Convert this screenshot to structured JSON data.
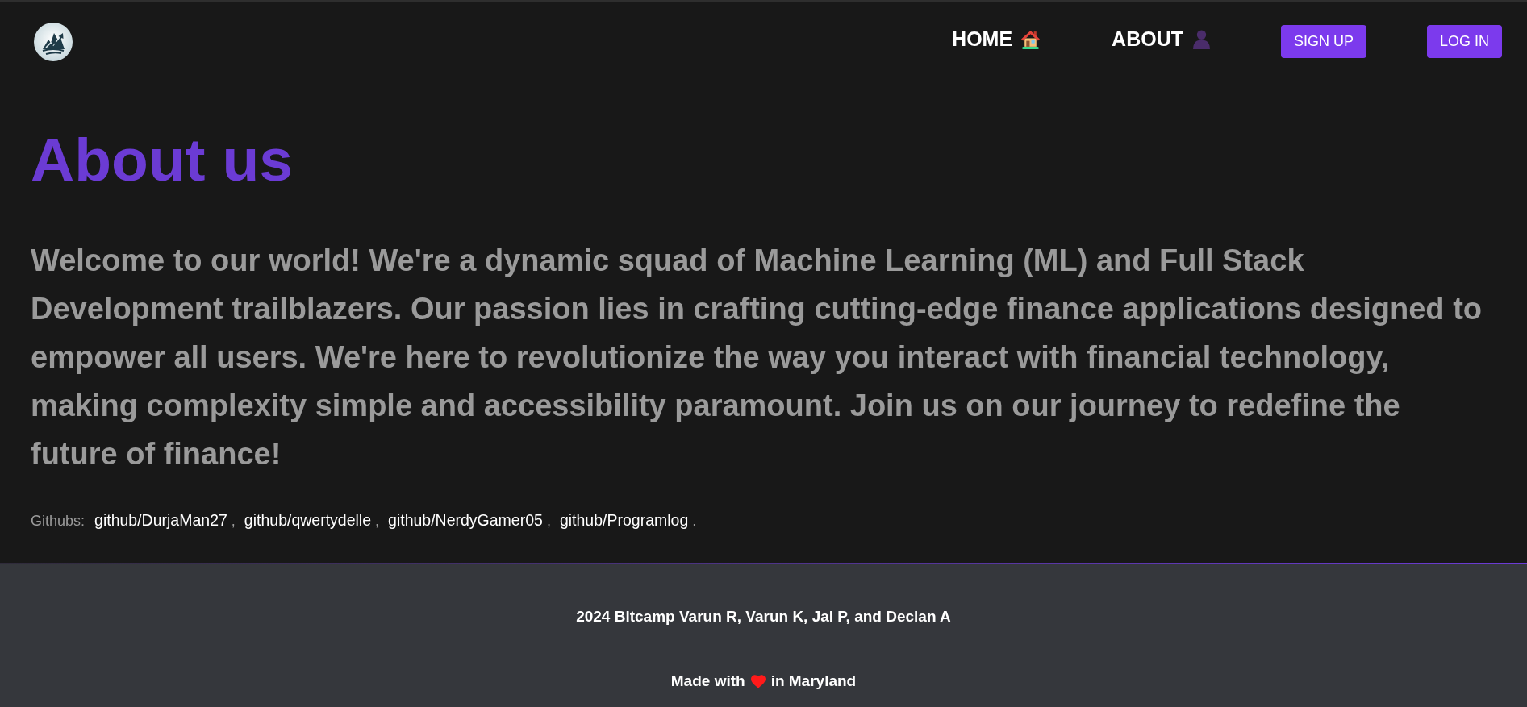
{
  "header": {
    "nav_links": [
      {
        "label": "HOME",
        "kind": "home"
      },
      {
        "label": "ABOUT",
        "kind": "about"
      }
    ],
    "buttons": [
      "SIGN UP",
      "LOG IN"
    ]
  },
  "main": {
    "title": "About us",
    "intro": "Welcome to our world! We're a dynamic squad of Machine Learning (ML) and Full Stack Development trailblazers. Our passion lies in crafting cutting-edge finance applications designed to empower all users. We're here to revolutionize the way you interact with financial technology, making complexity simple and accessibility paramount. Join us on our journey to redefine the future of finance!",
    "githubs": {
      "label": "Githubs:",
      "links": [
        {
          "text": "github/DurjaMan27",
          "after": ","
        },
        {
          "text": "github/qwertydelle",
          "after": ","
        },
        {
          "text": "github/NerdyGamer05",
          "after": ","
        },
        {
          "text": "github/Programlog",
          "after": "."
        }
      ]
    }
  },
  "footer": {
    "credit": "2024 Bitcamp Varun R, Varun K, Jai P, and Declan A",
    "made_with": {
      "before": "Made with",
      "after": "in Maryland"
    }
  }
}
